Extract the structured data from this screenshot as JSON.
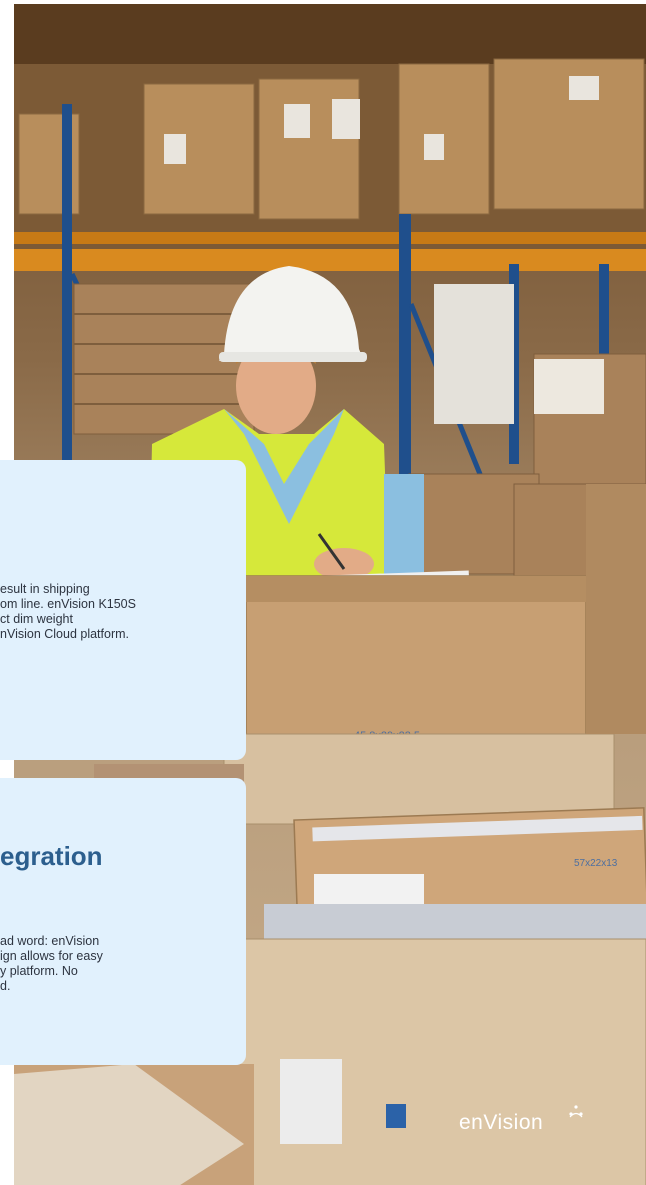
{
  "photo": {
    "subject": "Warehouse worker in white hard hat and yellow safety vest writing on a clipboard beside stacked cardboard boxes"
  },
  "box_labels": {
    "box_a": "45.8x29x23.5",
    "box_b": "57x22x13"
  },
  "card_dimensioning": {
    "body_lines": [
      "esult in shipping",
      "om line. enVision K150S",
      "ct dim weight",
      "nVision Cloud platform."
    ]
  },
  "card_integration": {
    "heading": "egration",
    "body_lines": [
      "ad word: enVision",
      "ign allows for easy",
      "y platform. No",
      "d."
    ]
  },
  "brand": {
    "logo_text": "enVision"
  },
  "colors": {
    "card_bg": "#e1f1fd",
    "heading": "#2c5f8e",
    "body_text": "#2d3440",
    "brand_text": "#ffffff"
  }
}
